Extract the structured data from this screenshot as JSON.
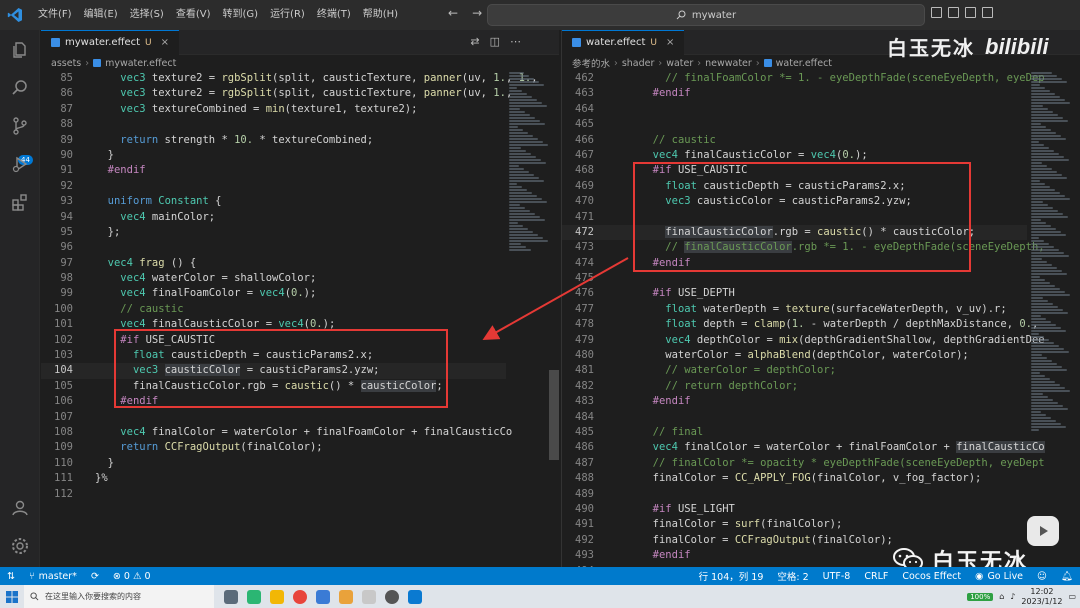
{
  "menu": [
    "文件(F)",
    "编辑(E)",
    "选择(S)",
    "查看(V)",
    "转到(G)",
    "运行(R)",
    "终端(T)",
    "帮助(H)"
  ],
  "search": {
    "text": "mywater"
  },
  "activity": {
    "scm_badge": "44"
  },
  "left": {
    "tab_label": "mywater.effect",
    "tab_status": "U",
    "breadcrumb": [
      "assets",
      "mywater.effect"
    ],
    "lines": [
      {
        "n": "85",
        "html": "    <span class=\"tp\">vec3</span> texture2 = <span class=\"fn\">rgbSplit</span>(split, causticTexture, <span class=\"fn\">panner</span>(uv, <span class=\"num\">1.</span>, <span class=\"num\">1.</span>,"
      },
      {
        "n": "86",
        "html": "    <span class=\"tp\">vec3</span> texture2 = <span class=\"fn\">rgbSplit</span>(split, causticTexture, <span class=\"fn\">panner</span>(uv, <span class=\"num\">1.</span>,"
      },
      {
        "n": "87",
        "html": "    <span class=\"tp\">vec3</span> textureCombined = <span class=\"fn\">min</span>(texture1, texture2);"
      },
      {
        "n": "88",
        "html": ""
      },
      {
        "n": "89",
        "html": "    <span class=\"kw\">return</span> strength * <span class=\"num\">10.</span> * textureCombined;"
      },
      {
        "n": "90",
        "html": "  }"
      },
      {
        "n": "91",
        "html": "  <span class=\"pp\">#endif</span>"
      },
      {
        "n": "92",
        "html": ""
      },
      {
        "n": "93",
        "html": "  <span class=\"kw\">uniform</span> <span class=\"tp\">Constant</span> {"
      },
      {
        "n": "94",
        "html": "    <span class=\"tp\">vec4</span> mainColor;"
      },
      {
        "n": "95",
        "html": "  };"
      },
      {
        "n": "96",
        "html": ""
      },
      {
        "n": "97",
        "html": "  <span class=\"tp\">vec4</span> <span class=\"fn\">frag</span> () {"
      },
      {
        "n": "98",
        "html": "    <span class=\"tp\">vec4</span> waterColor = shallowColor;"
      },
      {
        "n": "99",
        "html": "    <span class=\"tp\">vec4</span> finalFoamColor = <span class=\"tp\">vec4</span>(<span class=\"num\">0.</span>);"
      },
      {
        "n": "100",
        "html": "    <span class=\"cm\">// caustic</span>"
      },
      {
        "n": "101",
        "html": "    <span class=\"tp\">vec4</span> finalCausticColor = <span class=\"tp\">vec4</span>(<span class=\"num\">0.</span>);"
      },
      {
        "n": "102",
        "html": "    <span class=\"pp\">#if</span> USE_CAUSTIC"
      },
      {
        "n": "103",
        "html": "      <span class=\"tp\">float</span> causticDepth = causticParams2.x;"
      },
      {
        "n": "104",
        "html": "      <span class=\"tp\">vec3</span> <span class=\"hl-word\">causticColor</span> = causticParams2.yzw;",
        "cur": true
      },
      {
        "n": "105",
        "html": "      finalCausticColor.rgb = <span class=\"fn\">caustic</span>() * <span class=\"hl-word\">causticColor</span>;"
      },
      {
        "n": "106",
        "html": "    <span class=\"pp\">#endif</span>"
      },
      {
        "n": "107",
        "html": ""
      },
      {
        "n": "108",
        "html": "    <span class=\"tp\">vec4</span> finalColor = waterColor + finalFoamColor + finalCausticCo"
      },
      {
        "n": "109",
        "html": "    <span class=\"kw\">return</span> <span class=\"fn\">CCFragOutput</span>(finalColor);"
      },
      {
        "n": "110",
        "html": "  }"
      },
      {
        "n": "111",
        "html": "}%"
      },
      {
        "n": "112",
        "html": ""
      }
    ]
  },
  "right": {
    "tab_label": "water.effect",
    "tab_status": "U",
    "breadcrumb": [
      "参考的水",
      "shader",
      "water",
      "newwater",
      "water.effect"
    ],
    "lines": [
      {
        "n": "462",
        "html": "    <span class=\"cm\">// finalFoamColor *= 1. - eyeDepthFade(sceneEyeDepth, eyeDep</span>"
      },
      {
        "n": "463",
        "html": "  <span class=\"pp\">#endif</span>"
      },
      {
        "n": "464",
        "html": ""
      },
      {
        "n": "465",
        "html": ""
      },
      {
        "n": "466",
        "html": "  <span class=\"cm\">// caustic</span>"
      },
      {
        "n": "467",
        "html": "  <span class=\"tp\">vec4</span> finalCausticColor = <span class=\"tp\">vec4</span>(<span class=\"num\">0.</span>);"
      },
      {
        "n": "468",
        "html": "  <span class=\"pp\">#if</span> USE_CAUSTIC"
      },
      {
        "n": "469",
        "html": "    <span class=\"tp\">float</span> causticDepth = causticParams2.x;"
      },
      {
        "n": "470",
        "html": "    <span class=\"tp\">vec3</span> causticColor = causticParams2.yzw;"
      },
      {
        "n": "471",
        "html": ""
      },
      {
        "n": "472",
        "html": "    <span class=\"hl-word\">finalCausticColor</span>.rgb = <span class=\"fn\">caustic</span>() * causticColor;",
        "cur": true
      },
      {
        "n": "473",
        "html": "    <span class=\"cm\">// <span class=\"hl-word\">finalCausticColor</span>.rgb *= 1. - eyeDepthFade(sceneEyeDepth,</span>"
      },
      {
        "n": "474",
        "html": "  <span class=\"pp\">#endif</span>"
      },
      {
        "n": "475",
        "html": ""
      },
      {
        "n": "476",
        "html": "  <span class=\"pp\">#if</span> USE_DEPTH"
      },
      {
        "n": "477",
        "html": "    <span class=\"tp\">float</span> waterDepth = <span class=\"fn\">texture</span>(surfaceWaterDepth, v_uv).r;"
      },
      {
        "n": "478",
        "html": "    <span class=\"tp\">float</span> depth = <span class=\"fn\">clamp</span>(<span class=\"num\">1.</span> - waterDepth / depthMaxDistance, <span class=\"num\">0.</span>,"
      },
      {
        "n": "479",
        "html": "    <span class=\"tp\">vec4</span> depthColor = <span class=\"fn\">mix</span>(depthGradientShallow, depthGradientDee"
      },
      {
        "n": "480",
        "html": "    waterColor = <span class=\"fn\">alphaBlend</span>(depthColor, waterColor);"
      },
      {
        "n": "481",
        "html": "    <span class=\"cm\">// waterColor = depthColor;</span>"
      },
      {
        "n": "482",
        "html": "    <span class=\"cm\">// return depthColor;</span>"
      },
      {
        "n": "483",
        "html": "  <span class=\"pp\">#endif</span>"
      },
      {
        "n": "484",
        "html": ""
      },
      {
        "n": "485",
        "html": "  <span class=\"cm\">// final</span>"
      },
      {
        "n": "486",
        "html": "  <span class=\"tp\">vec4</span> finalColor = waterColor + finalFoamColor + <span class=\"hl-word\">finalCausticCo</span>"
      },
      {
        "n": "487",
        "html": "  <span class=\"cm\">// finalColor *= opacity * eyeDepthFade(sceneEyeDepth, eyeDept</span>"
      },
      {
        "n": "488",
        "html": "  finalColor = <span class=\"fn\">CC_APPLY_FOG</span>(finalColor, v_fog_factor);"
      },
      {
        "n": "489",
        "html": ""
      },
      {
        "n": "490",
        "html": "  <span class=\"pp\">#if</span> USE_LIGHT"
      },
      {
        "n": "491",
        "html": "  finalColor = <span class=\"fn\">surf</span>(finalColor);"
      },
      {
        "n": "492",
        "html": "  finalColor = <span class=\"fn\">CCFragOutput</span>(finalColor);"
      },
      {
        "n": "493",
        "html": "  <span class=\"pp\">#endif</span>"
      },
      {
        "n": "494",
        "html": ""
      }
    ]
  },
  "watermark": {
    "top_text": "白玉无冰",
    "top_logo": "bilibili",
    "bottom_text": "白玉无冰"
  },
  "status": {
    "branch": "master*",
    "problems": "⊗ 0 ⚠ 0",
    "position": "行 104，列 19",
    "spaces": "空格: 2",
    "encoding": "UTF-8",
    "eol": "CRLF",
    "language": "Cocos Effect",
    "golive": "Go Live"
  },
  "taskbar": {
    "search_placeholder": "在这里输入你要搜索的内容",
    "battery": "100%",
    "time": "12:02",
    "date": "2023/1/12"
  },
  "colors": {
    "accent": "#007acc",
    "annotation": "#e53935",
    "editor_bg": "#1e1e1e"
  }
}
